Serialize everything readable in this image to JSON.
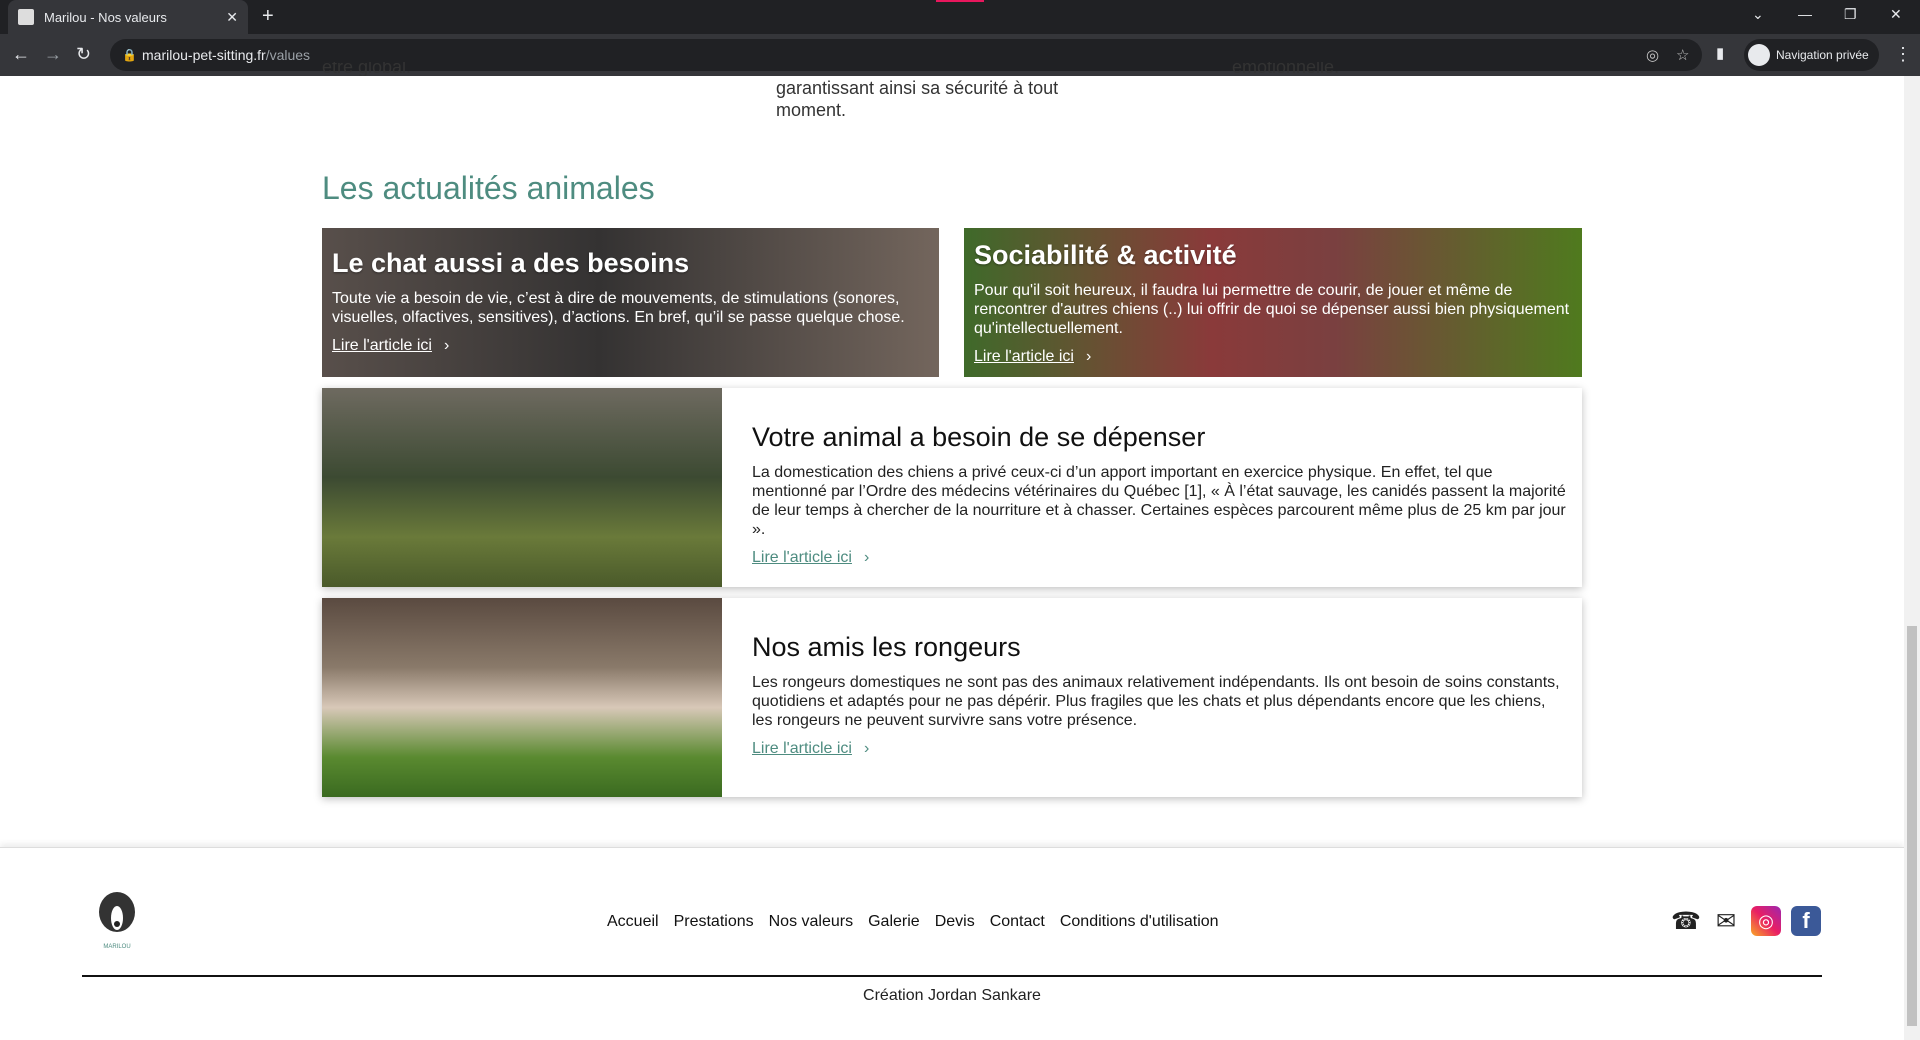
{
  "browser": {
    "tab_title": "Marilou - Nos valeurs",
    "url_host": "marilou-pet-sitting.fr",
    "url_path": "/values",
    "private_label": "Navigation privée"
  },
  "top_fragments": [
    "être global.",
    "garantissant ainsi sa sécurité à tout moment.",
    "émotionnelle."
  ],
  "section_title": "Les actualités animales",
  "overlay_cards": [
    {
      "title": "Le chat aussi a des besoins",
      "text": "Toute vie a besoin de vie, c’est à dire de mouvements, de stimulations (sonores, visuelles, olfactives, sensitives), d’actions. En bref, qu’il se passe quelque chose.",
      "link": "Lire l'article ici"
    },
    {
      "title": "Sociabilité & activité",
      "text": "Pour qu'il soit heureux, il faudra lui permettre de courir, de jouer et même de rencontrer d'autres chiens (..) lui offrir de quoi se dépenser aussi bien physiquement qu'intellectuellement.",
      "link": "Lire l'article ici"
    }
  ],
  "row_cards": [
    {
      "title": "Votre animal a besoin de se dépenser",
      "text": "La domestication des chiens a privé ceux-ci d’un apport important en exercice physique. En effet, tel que mentionné par l’Ordre des médecins vétérinaires du Québec [1], « À l’état sauvage, les canidés passent la majorité de leur temps à chercher de la nourriture et à chasser. Certaines espèces parcourent même plus de 25 km par jour ».",
      "link": "Lire l'article ici"
    },
    {
      "title": "Nos amis les rongeurs",
      "text": "Les rongeurs domestiques ne sont pas des animaux relativement indépendants. Ils ont besoin de soins constants, quotidiens et adaptés pour ne pas dépérir. Plus fragiles que les chats et plus dépendants encore que les chiens, les rongeurs ne peuvent survivre sans votre présence.",
      "link": "Lire l'article ici"
    }
  ],
  "footer": {
    "nav": [
      "Accueil",
      "Prestations",
      "Nos valeurs",
      "Galerie",
      "Devis",
      "Contact",
      "Conditions d'utilisation"
    ],
    "credit": "Création Jordan Sankare",
    "logo_text": "MARILOU"
  },
  "colors": {
    "accent": "#4e8c80"
  }
}
